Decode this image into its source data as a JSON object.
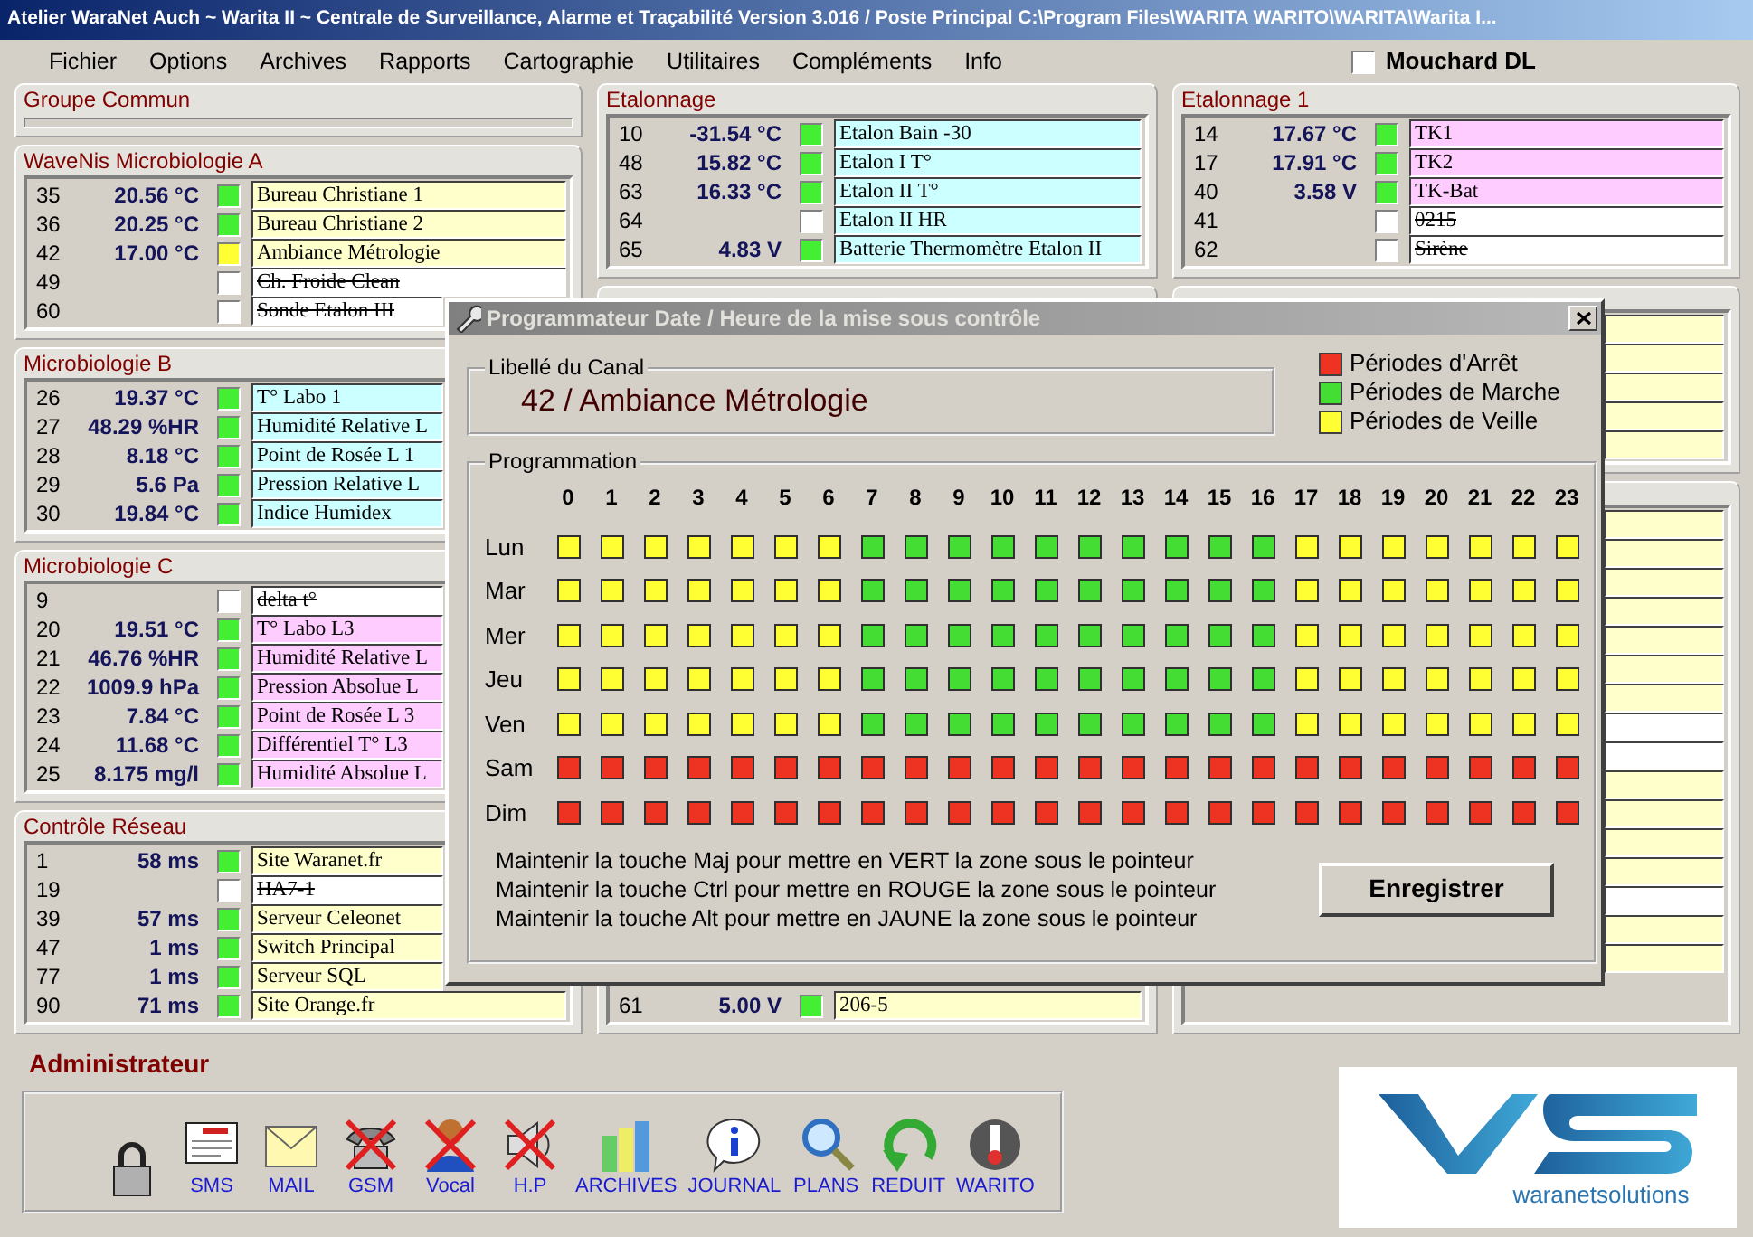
{
  "window": {
    "title": "Atelier WaraNet Auch ~ Warita II ~ Centrale de Surveillance, Alarme et Traçabilité  Version 3.016 /  Poste Principal C:\\Program Files\\WARITA WARITO\\WARITA\\Warita I..."
  },
  "menu": [
    "Fichier",
    "Options",
    "Archives",
    "Rapports",
    "Cartographie",
    "Utilitaires",
    "Compléments",
    "Info"
  ],
  "mouchard": {
    "label": "Mouchard DL",
    "checked": false
  },
  "columns": [
    {
      "panels": [
        {
          "title": "Groupe Commun"
        },
        {
          "title": "WaveNis Microbiologie A",
          "rows": [
            {
              "number": "35",
              "value": "20.56 °C",
              "indicator": {
                "color": "#44ee33"
              },
              "label": "Bureau Christiane 1",
              "color": "#ffffcc",
              "disabled": false
            },
            {
              "number": "36",
              "value": "20.25 °C",
              "indicator": {
                "color": "#44ee33"
              },
              "label": "Bureau Christiane 2",
              "color": "#ffffcc",
              "disabled": false
            },
            {
              "number": "42",
              "value": "17.00 °C",
              "indicator": {
                "color": "#ffff33"
              },
              "label": "Ambiance Métrologie",
              "color": "#ffffcc",
              "disabled": false
            },
            {
              "number": "49",
              "indicator": {
                "color": "#ffffff"
              },
              "label": "Ch. Froide Clean",
              "color": "#ffffff",
              "disabled": true
            },
            {
              "number": "60",
              "indicator": {
                "color": "#ffffff"
              },
              "label": "Sonde Etalon III",
              "color": "#ffffff",
              "disabled": true
            }
          ]
        },
        {
          "title": "Microbiologie B",
          "rows": [
            {
              "number": "26",
              "value": "19.37 °C",
              "indicator": {
                "color": "#44ee33"
              },
              "label": "T° Labo 1",
              "color": "#ccffff",
              "disabled": false
            },
            {
              "number": "27",
              "value": "48.29 %HR",
              "indicator": {
                "color": "#44ee33"
              },
              "label": "Humidité Relative L",
              "color": "#ccffff",
              "disabled": false
            },
            {
              "number": "28",
              "value": "8.18 °C",
              "indicator": {
                "color": "#44ee33"
              },
              "label": "Point de Rosée L 1",
              "color": "#ccffff",
              "disabled": false
            },
            {
              "number": "29",
              "value": "5.6 Pa",
              "indicator": {
                "color": "#44ee33"
              },
              "label": "Pression Relative L",
              "color": "#ccffff",
              "disabled": false
            },
            {
              "number": "30",
              "value": "19.84 °C",
              "indicator": {
                "color": "#44ee33"
              },
              "label": "Indice Humidex",
              "color": "#ccffff",
              "disabled": false
            }
          ]
        },
        {
          "title": "Microbiologie C",
          "rows": [
            {
              "number": "9",
              "indicator": {
                "color": "#ffffff"
              },
              "label": "delta t°",
              "color": "#ffffff",
              "disabled": true
            },
            {
              "number": "20",
              "value": "19.51 °C",
              "indicator": {
                "color": "#44ee33"
              },
              "label": "T° Labo L3",
              "color": "#ffccff",
              "disabled": false
            },
            {
              "number": "21",
              "value": "46.76 %HR",
              "indicator": {
                "color": "#44ee33"
              },
              "label": "Humidité Relative L",
              "color": "#ffccff",
              "disabled": false
            },
            {
              "number": "22",
              "value": "1009.9 hPa",
              "indicator": {
                "color": "#44ee33"
              },
              "label": "Pression Absolue L",
              "color": "#ffccff",
              "disabled": false
            },
            {
              "number": "23",
              "value": "7.84 °C",
              "indicator": {
                "color": "#44ee33"
              },
              "label": "Point de Rosée L 3",
              "color": "#ffccff",
              "disabled": false
            },
            {
              "number": "24",
              "value": "11.68 °C",
              "indicator": {
                "color": "#44ee33"
              },
              "label": "Différentiel T° L3",
              "color": "#ffccff",
              "disabled": false
            },
            {
              "number": "25",
              "value": "8.175 mg/l",
              "indicator": {
                "color": "#44ee33"
              },
              "label": "Humidité Absolue L",
              "color": "#ffccff",
              "disabled": false
            }
          ]
        },
        {
          "title": "Contrôle Réseau",
          "rows": [
            {
              "number": "1",
              "value": "58 ms",
              "indicator": {
                "color": "#44ee33"
              },
              "label": "Site Waranet.fr",
              "color": "#ffffcc",
              "disabled": false
            },
            {
              "number": "19",
              "indicator": {
                "color": "#ffffff"
              },
              "label": "HA7-1",
              "color": "#ffffff",
              "disabled": true
            },
            {
              "number": "39",
              "value": "57 ms",
              "indicator": {
                "color": "#44ee33"
              },
              "label": "Serveur Celeonet",
              "color": "#ffffcc",
              "disabled": false
            },
            {
              "number": "47",
              "value": "1 ms",
              "indicator": {
                "color": "#44ee33"
              },
              "label": "Switch Principal",
              "color": "#ffffcc",
              "disabled": false
            },
            {
              "number": "77",
              "value": "1 ms",
              "indicator": {
                "color": "#44ee33"
              },
              "label": "Serveur SQL",
              "color": "#ffffcc",
              "disabled": false
            },
            {
              "number": "90",
              "value": "71 ms",
              "indicator": {
                "color": "#44ee33"
              },
              "label": "Site Orange.fr",
              "color": "#ffffcc",
              "disabled": false
            }
          ]
        }
      ]
    },
    {
      "panels": [
        {
          "title": "Etalonnage",
          "rows": [
            {
              "number": "10",
              "value": "-31.54 °C",
              "indicator": {
                "color": "#44ee33"
              },
              "label": "Etalon Bain -30",
              "color": "#ccffff",
              "disabled": false
            },
            {
              "number": "48",
              "value": "15.82 °C",
              "indicator": {
                "color": "#44ee33"
              },
              "label": "Etalon I T°",
              "color": "#ccffff",
              "disabled": false
            },
            {
              "number": "63",
              "value": "16.33 °C",
              "indicator": {
                "color": "#44ee33"
              },
              "label": "Etalon II T°",
              "color": "#ccffff",
              "disabled": false
            },
            {
              "number": "64",
              "indicator": {
                "color": "#ffffff"
              },
              "label": "Etalon II HR",
              "color": "#ccffff",
              "disabled": false
            },
            {
              "number": "65",
              "value": "4.83 V",
              "indicator": {
                "color": "#44ee33"
              },
              "label": "Batterie Thermomètre Etalon II",
              "color": "#ccffff",
              "disabled": false
            }
          ]
        },
        {
          "rows": [
            {
              "number": "61",
              "value": "5.00 V",
              "indicator": {
                "color": "#44ee33"
              },
              "label": "206-5",
              "color": "#ffffcc",
              "disabled": false
            }
          ]
        }
      ]
    },
    {
      "panels": [
        {
          "title": "Etalonnage 1",
          "rows": [
            {
              "number": "14",
              "value": "17.67 °C",
              "indicator": {
                "color": "#44ee33"
              },
              "label": "TK1",
              "color": "#ffccff",
              "disabled": false
            },
            {
              "number": "17",
              "value": "17.91 °C",
              "indicator": {
                "color": "#44ee33"
              },
              "label": "TK2",
              "color": "#ffccff",
              "disabled": false
            },
            {
              "number": "40",
              "value": "3.58 V",
              "indicator": {
                "color": "#44ee33"
              },
              "label": "TK-Bat",
              "color": "#ffccff",
              "disabled": false
            },
            {
              "number": "41",
              "indicator": {
                "color": "#ffffff"
              },
              "label": "0215",
              "color": "#ffffff",
              "disabled": true
            },
            {
              "number": "62",
              "indicator": {
                "color": "#ffffff"
              },
              "label": "Sirène",
              "color": "#ffffff",
              "disabled": true
            }
          ]
        },
        {
          "rows": [
            {
              "color": "#ffffcc"
            },
            {
              "color": "#ffffcc"
            },
            {
              "color": "#ffffcc"
            },
            {
              "color": "#ffffcc"
            },
            {
              "color": "#ffffcc"
            }
          ]
        },
        {
          "rows": [
            {
              "color": "#ffffcc"
            },
            {
              "color": "#ffffcc"
            },
            {
              "color": "#ffffcc"
            },
            {
              "color": "#ffffcc"
            },
            {
              "color": "#ffffcc"
            },
            {
              "color": "#ffffcc"
            },
            {
              "color": "#ffffcc"
            },
            {
              "color": "#ffffff"
            },
            {
              "color": "#ffffff"
            },
            {
              "color": "#ffffcc"
            },
            {
              "color": "#ffffcc"
            },
            {
              "color": "#ffffcc"
            },
            {
              "color": "#ffffcc"
            },
            {
              "color": "#ffffff"
            },
            {
              "color": "#ffffcc"
            },
            {
              "color": "#ffffcc"
            }
          ]
        }
      ]
    }
  ],
  "dialog": {
    "title": "Programmateur Date / Heure de la mise sous contrôle",
    "channel_legend": "Libellé du Canal",
    "channel": "42 / Ambiance Métrologie",
    "legend": [
      {
        "label": "Périodes d'Arrêt",
        "color": "#ee3322"
      },
      {
        "label": "Périodes de Marche",
        "color": "#44dd33"
      },
      {
        "label": "Périodes de Veille",
        "color": "#ffff33"
      }
    ],
    "program_legend": "Programmation",
    "hours": [
      "0",
      "1",
      "2",
      "3",
      "4",
      "5",
      "6",
      "7",
      "8",
      "9",
      "10",
      "11",
      "12",
      "13",
      "14",
      "15",
      "16",
      "17",
      "18",
      "19",
      "20",
      "21",
      "22",
      "23"
    ],
    "schedule": [
      {
        "day": "Lun",
        "slots": [
          {
            "color": "#ffff33"
          },
          {
            "color": "#ffff33"
          },
          {
            "color": "#ffff33"
          },
          {
            "color": "#ffff33"
          },
          {
            "color": "#ffff33"
          },
          {
            "color": "#ffff33"
          },
          {
            "color": "#ffff33"
          },
          {
            "color": "#44dd33"
          },
          {
            "color": "#44dd33"
          },
          {
            "color": "#44dd33"
          },
          {
            "color": "#44dd33"
          },
          {
            "color": "#44dd33"
          },
          {
            "color": "#44dd33"
          },
          {
            "color": "#44dd33"
          },
          {
            "color": "#44dd33"
          },
          {
            "color": "#44dd33"
          },
          {
            "color": "#44dd33"
          },
          {
            "color": "#ffff33"
          },
          {
            "color": "#ffff33"
          },
          {
            "color": "#ffff33"
          },
          {
            "color": "#ffff33"
          },
          {
            "color": "#ffff33"
          },
          {
            "color": "#ffff33"
          },
          {
            "color": "#ffff33"
          }
        ]
      },
      {
        "day": "Mar",
        "slots": [
          {
            "color": "#ffff33"
          },
          {
            "color": "#ffff33"
          },
          {
            "color": "#ffff33"
          },
          {
            "color": "#ffff33"
          },
          {
            "color": "#ffff33"
          },
          {
            "color": "#ffff33"
          },
          {
            "color": "#ffff33"
          },
          {
            "color": "#44dd33"
          },
          {
            "color": "#44dd33"
          },
          {
            "color": "#44dd33"
          },
          {
            "color": "#44dd33"
          },
          {
            "color": "#44dd33"
          },
          {
            "color": "#44dd33"
          },
          {
            "color": "#44dd33"
          },
          {
            "color": "#44dd33"
          },
          {
            "color": "#44dd33"
          },
          {
            "color": "#44dd33"
          },
          {
            "color": "#ffff33"
          },
          {
            "color": "#ffff33"
          },
          {
            "color": "#ffff33"
          },
          {
            "color": "#ffff33"
          },
          {
            "color": "#ffff33"
          },
          {
            "color": "#ffff33"
          },
          {
            "color": "#ffff33"
          }
        ]
      },
      {
        "day": "Mer",
        "slots": [
          {
            "color": "#ffff33"
          },
          {
            "color": "#ffff33"
          },
          {
            "color": "#ffff33"
          },
          {
            "color": "#ffff33"
          },
          {
            "color": "#ffff33"
          },
          {
            "color": "#ffff33"
          },
          {
            "color": "#ffff33"
          },
          {
            "color": "#44dd33"
          },
          {
            "color": "#44dd33"
          },
          {
            "color": "#44dd33"
          },
          {
            "color": "#44dd33"
          },
          {
            "color": "#44dd33"
          },
          {
            "color": "#44dd33"
          },
          {
            "color": "#44dd33"
          },
          {
            "color": "#44dd33"
          },
          {
            "color": "#44dd33"
          },
          {
            "color": "#44dd33"
          },
          {
            "color": "#ffff33"
          },
          {
            "color": "#ffff33"
          },
          {
            "color": "#ffff33"
          },
          {
            "color": "#ffff33"
          },
          {
            "color": "#ffff33"
          },
          {
            "color": "#ffff33"
          },
          {
            "color": "#ffff33"
          }
        ]
      },
      {
        "day": "Jeu",
        "slots": [
          {
            "color": "#ffff33"
          },
          {
            "color": "#ffff33"
          },
          {
            "color": "#ffff33"
          },
          {
            "color": "#ffff33"
          },
          {
            "color": "#ffff33"
          },
          {
            "color": "#ffff33"
          },
          {
            "color": "#ffff33"
          },
          {
            "color": "#44dd33"
          },
          {
            "color": "#44dd33"
          },
          {
            "color": "#44dd33"
          },
          {
            "color": "#44dd33"
          },
          {
            "color": "#44dd33"
          },
          {
            "color": "#44dd33"
          },
          {
            "color": "#44dd33"
          },
          {
            "color": "#44dd33"
          },
          {
            "color": "#44dd33"
          },
          {
            "color": "#44dd33"
          },
          {
            "color": "#ffff33"
          },
          {
            "color": "#ffff33"
          },
          {
            "color": "#ffff33"
          },
          {
            "color": "#ffff33"
          },
          {
            "color": "#ffff33"
          },
          {
            "color": "#ffff33"
          },
          {
            "color": "#ffff33"
          }
        ]
      },
      {
        "day": "Ven",
        "slots": [
          {
            "color": "#ffff33"
          },
          {
            "color": "#ffff33"
          },
          {
            "color": "#ffff33"
          },
          {
            "color": "#ffff33"
          },
          {
            "color": "#ffff33"
          },
          {
            "color": "#ffff33"
          },
          {
            "color": "#ffff33"
          },
          {
            "color": "#44dd33"
          },
          {
            "color": "#44dd33"
          },
          {
            "color": "#44dd33"
          },
          {
            "color": "#44dd33"
          },
          {
            "color": "#44dd33"
          },
          {
            "color": "#44dd33"
          },
          {
            "color": "#44dd33"
          },
          {
            "color": "#44dd33"
          },
          {
            "color": "#44dd33"
          },
          {
            "color": "#44dd33"
          },
          {
            "color": "#ffff33"
          },
          {
            "color": "#ffff33"
          },
          {
            "color": "#ffff33"
          },
          {
            "color": "#ffff33"
          },
          {
            "color": "#ffff33"
          },
          {
            "color": "#ffff33"
          },
          {
            "color": "#ffff33"
          }
        ]
      },
      {
        "day": "Sam",
        "slots": [
          {
            "color": "#ee3322"
          },
          {
            "color": "#ee3322"
          },
          {
            "color": "#ee3322"
          },
          {
            "color": "#ee3322"
          },
          {
            "color": "#ee3322"
          },
          {
            "color": "#ee3322"
          },
          {
            "color": "#ee3322"
          },
          {
            "color": "#ee3322"
          },
          {
            "color": "#ee3322"
          },
          {
            "color": "#ee3322"
          },
          {
            "color": "#ee3322"
          },
          {
            "color": "#ee3322"
          },
          {
            "color": "#ee3322"
          },
          {
            "color": "#ee3322"
          },
          {
            "color": "#ee3322"
          },
          {
            "color": "#ee3322"
          },
          {
            "color": "#ee3322"
          },
          {
            "color": "#ee3322"
          },
          {
            "color": "#ee3322"
          },
          {
            "color": "#ee3322"
          },
          {
            "color": "#ee3322"
          },
          {
            "color": "#ee3322"
          },
          {
            "color": "#ee3322"
          },
          {
            "color": "#ee3322"
          }
        ]
      },
      {
        "day": "Dim",
        "slots": [
          {
            "color": "#ee3322"
          },
          {
            "color": "#ee3322"
          },
          {
            "color": "#ee3322"
          },
          {
            "color": "#ee3322"
          },
          {
            "color": "#ee3322"
          },
          {
            "color": "#ee3322"
          },
          {
            "color": "#ee3322"
          },
          {
            "color": "#ee3322"
          },
          {
            "color": "#ee3322"
          },
          {
            "color": "#ee3322"
          },
          {
            "color": "#ee3322"
          },
          {
            "color": "#ee3322"
          },
          {
            "color": "#ee3322"
          },
          {
            "color": "#ee3322"
          },
          {
            "color": "#ee3322"
          },
          {
            "color": "#ee3322"
          },
          {
            "color": "#ee3322"
          },
          {
            "color": "#ee3322"
          },
          {
            "color": "#ee3322"
          },
          {
            "color": "#ee3322"
          },
          {
            "color": "#ee3322"
          },
          {
            "color": "#ee3322"
          },
          {
            "color": "#ee3322"
          },
          {
            "color": "#ee3322"
          }
        ]
      }
    ],
    "instructions": [
      "Maintenir la touche Maj pour mettre en VERT la zone sous le pointeur",
      "Maintenir la touche Ctrl pour mettre en ROUGE la zone sous le pointeur",
      "Maintenir la touche Alt pour mettre en JAUNE la zone sous le pointeur"
    ],
    "save_button": "Enregistrer"
  },
  "admin": {
    "title": "Administrateur",
    "tools": [
      {
        "kind": "lock",
        "crossed": false
      },
      {
        "kind": "memo",
        "label": "SMS",
        "crossed": false
      },
      {
        "kind": "mail",
        "label": "MAIL",
        "crossed": false
      },
      {
        "kind": "phone",
        "label": "GSM",
        "crossed": true
      },
      {
        "kind": "person",
        "label": "Vocal",
        "crossed": true
      },
      {
        "kind": "speaker",
        "label": "H.P",
        "crossed": true
      },
      {
        "kind": "chart",
        "label": "ARCHIVES",
        "crossed": false
      },
      {
        "kind": "info",
        "label": "JOURNAL",
        "crossed": false
      },
      {
        "kind": "magnifier",
        "label": "PLANS",
        "crossed": false
      },
      {
        "kind": "arrow",
        "label": "REDUIT",
        "crossed": false
      },
      {
        "kind": "thermometer",
        "label": "WARITO",
        "crossed": false
      }
    ]
  },
  "logo": {
    "text": "waranetsolutions"
  }
}
